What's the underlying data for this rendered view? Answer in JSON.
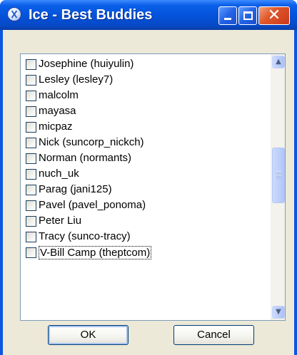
{
  "window": {
    "title": "Ice - Best Buddies",
    "minimize_glyph": "",
    "maximize_glyph": "",
    "close_glyph": "✕"
  },
  "buddy_list": {
    "items": [
      {
        "label": "Josephine (huiyulin)",
        "checked": false
      },
      {
        "label": "Lesley (lesley7)",
        "checked": false
      },
      {
        "label": "malcolm",
        "checked": false
      },
      {
        "label": "mayasa",
        "checked": false
      },
      {
        "label": "micpaz",
        "checked": false
      },
      {
        "label": "Nick (suncorp_nickch)",
        "checked": false
      },
      {
        "label": "Norman (normants)",
        "checked": false
      },
      {
        "label": "nuch_uk",
        "checked": false
      },
      {
        "label": "Parag (jani125)",
        "checked": false
      },
      {
        "label": "Pavel (pavel_ponoma)",
        "checked": false
      },
      {
        "label": "Peter Liu",
        "checked": false
      },
      {
        "label": "Tracy (sunco-tracy)",
        "checked": false
      },
      {
        "label": "V-Bill Camp (theptcom)",
        "checked": false
      }
    ]
  },
  "scrollbar": {
    "up_glyph": "▲",
    "down_glyph": "▼"
  },
  "buttons": {
    "ok_label": "OK",
    "cancel_label": "Cancel"
  }
}
